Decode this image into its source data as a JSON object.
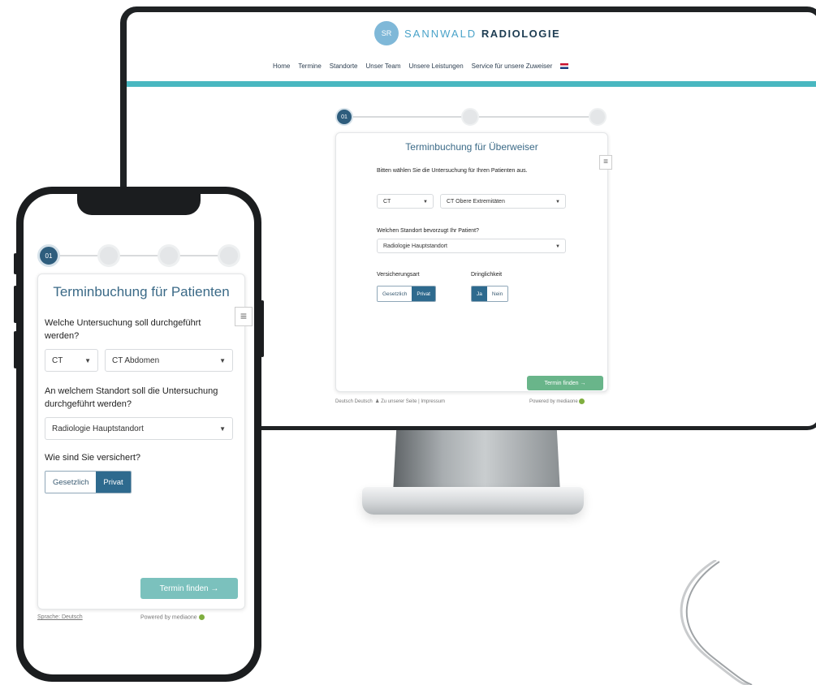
{
  "desktop": {
    "logo": {
      "mark": "SR",
      "name_light": "SANNWALD",
      "name_bold": "RADIOLOGIE"
    },
    "nav": [
      "Home",
      "Termine",
      "Standorte",
      "Unser Team",
      "Unsere Leistungen",
      "Service für unsere Zuweiser"
    ],
    "step_active_label": "01",
    "card": {
      "title": "Terminbuchung für Überweiser",
      "q_exam": "Bitten wählen Sie die Untersuchung für Ihren Patienten aus.",
      "modality": "CT",
      "exam": "CT Obere Extremitäten",
      "q_location": "Welchen Standort bevorzugt Ihr Patient?",
      "location": "Radiologie Hauptstandort",
      "insurance_label": "Versicherungsart",
      "insurance_options": [
        "Gesetzlich",
        "Privat"
      ],
      "urgency_label": "Dringlichkeit",
      "urgency_options": [
        "Ja",
        "Nein"
      ],
      "cta": "Termin finden →"
    },
    "footer_left": "Deutsch Deutsch",
    "footer_mid": "Zu unserer Seite | Impressum",
    "footer_right": "Powered by mediaone"
  },
  "phone": {
    "step_active_label": "01",
    "card": {
      "title": "Terminbuchung für Patienten",
      "q_exam": "Welche Untersuchung soll durchgeführt werden?",
      "modality": "CT",
      "exam": "CT Abdomen",
      "q_location": "An welchem Standort soll die Untersuchung durchgeführt werden?",
      "location": "Radiologie Hauptstandort",
      "q_insurance": "Wie sind Sie versichert?",
      "insurance_options": [
        "Gesetzlich",
        "Privat"
      ],
      "cta": "Termin finden →"
    },
    "footer_left": "Sprache: Deutsch",
    "footer_right": "Powered by mediaone"
  },
  "colors": {
    "brand_teal": "#49b7c0",
    "brand_dark": "#2e5d7d",
    "cta_green": "#69b58a",
    "cta_teal": "#7bc1bd"
  },
  "icons": [
    "hamburger-menu-icon",
    "flag-uk-icon",
    "sprout-icon",
    "person-icon"
  ]
}
